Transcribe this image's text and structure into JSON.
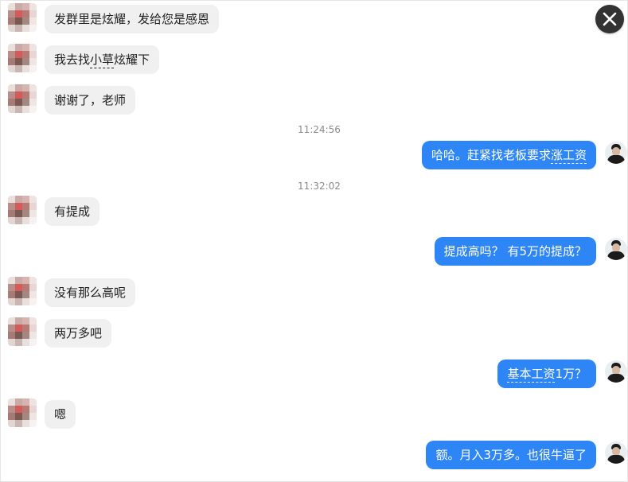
{
  "messages": [
    {
      "side": "left",
      "text": "发群里是炫耀，发给您是感恩"
    },
    {
      "side": "left",
      "parts": [
        "我去找",
        "小草",
        "炫耀下"
      ]
    },
    {
      "side": "left",
      "text": "谢谢了，老师"
    },
    {
      "side": "time",
      "text": "11:24:56"
    },
    {
      "side": "right",
      "parts": [
        "哈哈。赶紧找老板要求",
        "涨工资"
      ]
    },
    {
      "side": "time",
      "text": "11:32:02"
    },
    {
      "side": "left",
      "text": "有提成"
    },
    {
      "side": "right",
      "text": "提成高吗？ 有5万的提成？"
    },
    {
      "side": "left",
      "text": "没有那么高呢"
    },
    {
      "side": "left",
      "text": "两万多吧"
    },
    {
      "side": "right",
      "parts": [
        "基本工资",
        "1万？"
      ]
    },
    {
      "side": "left",
      "text": "嗯"
    },
    {
      "side": "right",
      "text": "额。月入3万多。也很牛逼了"
    }
  ],
  "colors": {
    "accent": "#2e86f6",
    "incoming_bubble": "#f0f0f0",
    "timestamp": "#8a8a8a",
    "close_button": "#333333"
  },
  "icons": {
    "close": "close-icon"
  }
}
